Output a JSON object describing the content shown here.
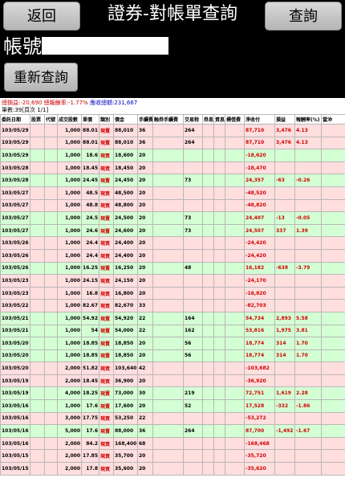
{
  "header": {
    "back_label": "返回",
    "title": "證券-對帳單查詢",
    "query_label": "查詢"
  },
  "account": {
    "label": "帳號:",
    "value": ""
  },
  "requery_label": "重新查詢",
  "summary": {
    "profit_text": "總損益:-20,690 總報酬率:-1.77%",
    "total_text": " 應收總額:231,667",
    "count_text": "筆數:39[頁次 1/1]"
  },
  "table": {
    "headers": [
      "委託日期",
      "股票",
      "代號",
      "成交股數",
      "單價",
      "類別",
      "價金",
      "手續費",
      "融券手續費",
      "交易稅",
      "券息",
      "資息",
      "標借費",
      "淨收付",
      "損益",
      "報酬率(%)",
      "當沖"
    ],
    "rows": [
      {
        "date": "103/05/29",
        "qty": "1,000",
        "price": "88.01",
        "type": "現賣",
        "amount": "88,010",
        "fee": "36",
        "tax": "264",
        "net": "87,710",
        "pl": "3,476",
        "ret": "4.13",
        "color": "pink"
      },
      {
        "date": "103/05/29",
        "qty": "1,000",
        "price": "88.01",
        "type": "現賣",
        "amount": "88,010",
        "fee": "36",
        "tax": "264",
        "net": "87,710",
        "pl": "3,476",
        "ret": "4.13",
        "color": "pink"
      },
      {
        "date": "103/05/29",
        "qty": "1,000",
        "price": "18.6",
        "type": "現買",
        "amount": "18,600",
        "fee": "20",
        "tax": "",
        "net": "-18,620",
        "pl": "",
        "ret": "",
        "color": "green"
      },
      {
        "date": "103/05/28",
        "qty": "1,000",
        "price": "18.45",
        "type": "現買",
        "amount": "18,450",
        "fee": "20",
        "tax": "",
        "net": "-18,470",
        "pl": "",
        "ret": "",
        "color": "pink"
      },
      {
        "date": "103/05/28",
        "qty": "1,000",
        "price": "24.45",
        "type": "現賣",
        "amount": "24,450",
        "fee": "20",
        "tax": "73",
        "net": "24,357",
        "pl": "-63",
        "ret": "-0.26",
        "color": "green"
      },
      {
        "date": "103/05/27",
        "qty": "1,000",
        "price": "48.5",
        "type": "現買",
        "amount": "48,500",
        "fee": "20",
        "tax": "",
        "net": "-48,520",
        "pl": "",
        "ret": "",
        "color": "pink"
      },
      {
        "date": "103/05/27",
        "qty": "1,000",
        "price": "48.8",
        "type": "現買",
        "amount": "48,800",
        "fee": "20",
        "tax": "",
        "net": "-48,820",
        "pl": "",
        "ret": "",
        "color": "pink"
      },
      {
        "date": "103/05/27",
        "qty": "1,000",
        "price": "24.5",
        "type": "現賣",
        "amount": "24,500",
        "fee": "20",
        "tax": "73",
        "net": "24,407",
        "pl": "-13",
        "ret": "-0.05",
        "color": "green"
      },
      {
        "date": "103/05/27",
        "qty": "1,000",
        "price": "24.6",
        "type": "現賣",
        "amount": "24,600",
        "fee": "20",
        "tax": "73",
        "net": "24,507",
        "pl": "337",
        "ret": "1.39",
        "color": "green"
      },
      {
        "date": "103/05/26",
        "qty": "1,000",
        "price": "24.4",
        "type": "現買",
        "amount": "24,400",
        "fee": "20",
        "tax": "",
        "net": "-24,420",
        "pl": "",
        "ret": "",
        "color": "pink"
      },
      {
        "date": "103/05/26",
        "qty": "1,000",
        "price": "24.4",
        "type": "現買",
        "amount": "24,400",
        "fee": "20",
        "tax": "",
        "net": "-24,420",
        "pl": "",
        "ret": "",
        "color": "pink"
      },
      {
        "date": "103/05/26",
        "qty": "1,000",
        "price": "16.25",
        "type": "現賣",
        "amount": "16,250",
        "fee": "20",
        "tax": "48",
        "net": "16,182",
        "pl": "-638",
        "ret": "-3.79",
        "color": "green"
      },
      {
        "date": "103/05/23",
        "qty": "1,000",
        "price": "24.15",
        "type": "現買",
        "amount": "24,150",
        "fee": "20",
        "tax": "",
        "net": "-24,170",
        "pl": "",
        "ret": "",
        "color": "pink"
      },
      {
        "date": "103/05/23",
        "qty": "1,000",
        "price": "16.8",
        "type": "現買",
        "amount": "16,800",
        "fee": "20",
        "tax": "",
        "net": "-16,820",
        "pl": "",
        "ret": "",
        "color": "pink"
      },
      {
        "date": "103/05/22",
        "qty": "1,000",
        "price": "82.67",
        "type": "現買",
        "amount": "82,670",
        "fee": "33",
        "tax": "",
        "net": "-82,703",
        "pl": "",
        "ret": "",
        "color": "pink"
      },
      {
        "date": "103/05/21",
        "qty": "1,000",
        "price": "54.92",
        "type": "現賣",
        "amount": "54,920",
        "fee": "22",
        "tax": "164",
        "net": "54,734",
        "pl": "2,893",
        "ret": "5.58",
        "color": "green"
      },
      {
        "date": "103/05/21",
        "qty": "1,000",
        "price": "54",
        "type": "現賣",
        "amount": "54,000",
        "fee": "22",
        "tax": "162",
        "net": "53,816",
        "pl": "1,975",
        "ret": "3.81",
        "color": "green"
      },
      {
        "date": "103/05/20",
        "qty": "1,000",
        "price": "18.85",
        "type": "現賣",
        "amount": "18,850",
        "fee": "20",
        "tax": "56",
        "net": "18,774",
        "pl": "314",
        "ret": "1.70",
        "color": "green"
      },
      {
        "date": "103/05/20",
        "qty": "1,000",
        "price": "18.85",
        "type": "現賣",
        "amount": "18,850",
        "fee": "20",
        "tax": "56",
        "net": "18,774",
        "pl": "314",
        "ret": "1.70",
        "color": "green"
      },
      {
        "date": "103/05/20",
        "qty": "2,000",
        "price": "51.82",
        "type": "現買",
        "amount": "103,640",
        "fee": "42",
        "tax": "",
        "net": "-103,682",
        "pl": "",
        "ret": "",
        "color": "pink"
      },
      {
        "date": "103/05/19",
        "qty": "2,000",
        "price": "18.45",
        "type": "現買",
        "amount": "36,900",
        "fee": "20",
        "tax": "",
        "net": "-36,920",
        "pl": "",
        "ret": "",
        "color": "pink"
      },
      {
        "date": "103/05/19",
        "qty": "4,000",
        "price": "18.25",
        "type": "現賣",
        "amount": "73,000",
        "fee": "30",
        "tax": "219",
        "net": "72,751",
        "pl": "1,619",
        "ret": "2.28",
        "color": "green"
      },
      {
        "date": "103/05/16",
        "qty": "1,000",
        "price": "17.6",
        "type": "現賣",
        "amount": "17,600",
        "fee": "20",
        "tax": "52",
        "net": "17,528",
        "pl": "-332",
        "ret": "-1.86",
        "color": "green"
      },
      {
        "date": "103/05/16",
        "qty": "3,000",
        "price": "17.75",
        "type": "現買",
        "amount": "53,250",
        "fee": "22",
        "tax": "",
        "net": "-53,272",
        "pl": "",
        "ret": "",
        "color": "pink"
      },
      {
        "date": "103/05/16",
        "qty": "5,000",
        "price": "17.6",
        "type": "現賣",
        "amount": "88,000",
        "fee": "36",
        "tax": "264",
        "net": "87,700",
        "pl": "-1,492",
        "ret": "-1.67",
        "color": "green"
      },
      {
        "date": "103/05/16",
        "qty": "2,000",
        "price": "84.2",
        "type": "現買",
        "amount": "168,400",
        "fee": "68",
        "tax": "",
        "net": "-168,468",
        "pl": "",
        "ret": "",
        "color": "pink"
      },
      {
        "date": "103/05/15",
        "qty": "2,000",
        "price": "17.85",
        "type": "現買",
        "amount": "35,700",
        "fee": "20",
        "tax": "",
        "net": "-35,720",
        "pl": "",
        "ret": "",
        "color": "pink"
      },
      {
        "date": "103/05/15",
        "qty": "2,000",
        "price": "17.8",
        "type": "現買",
        "amount": "35,600",
        "fee": "20",
        "tax": "",
        "net": "-35,620",
        "pl": "",
        "ret": "",
        "color": "pink"
      }
    ]
  }
}
